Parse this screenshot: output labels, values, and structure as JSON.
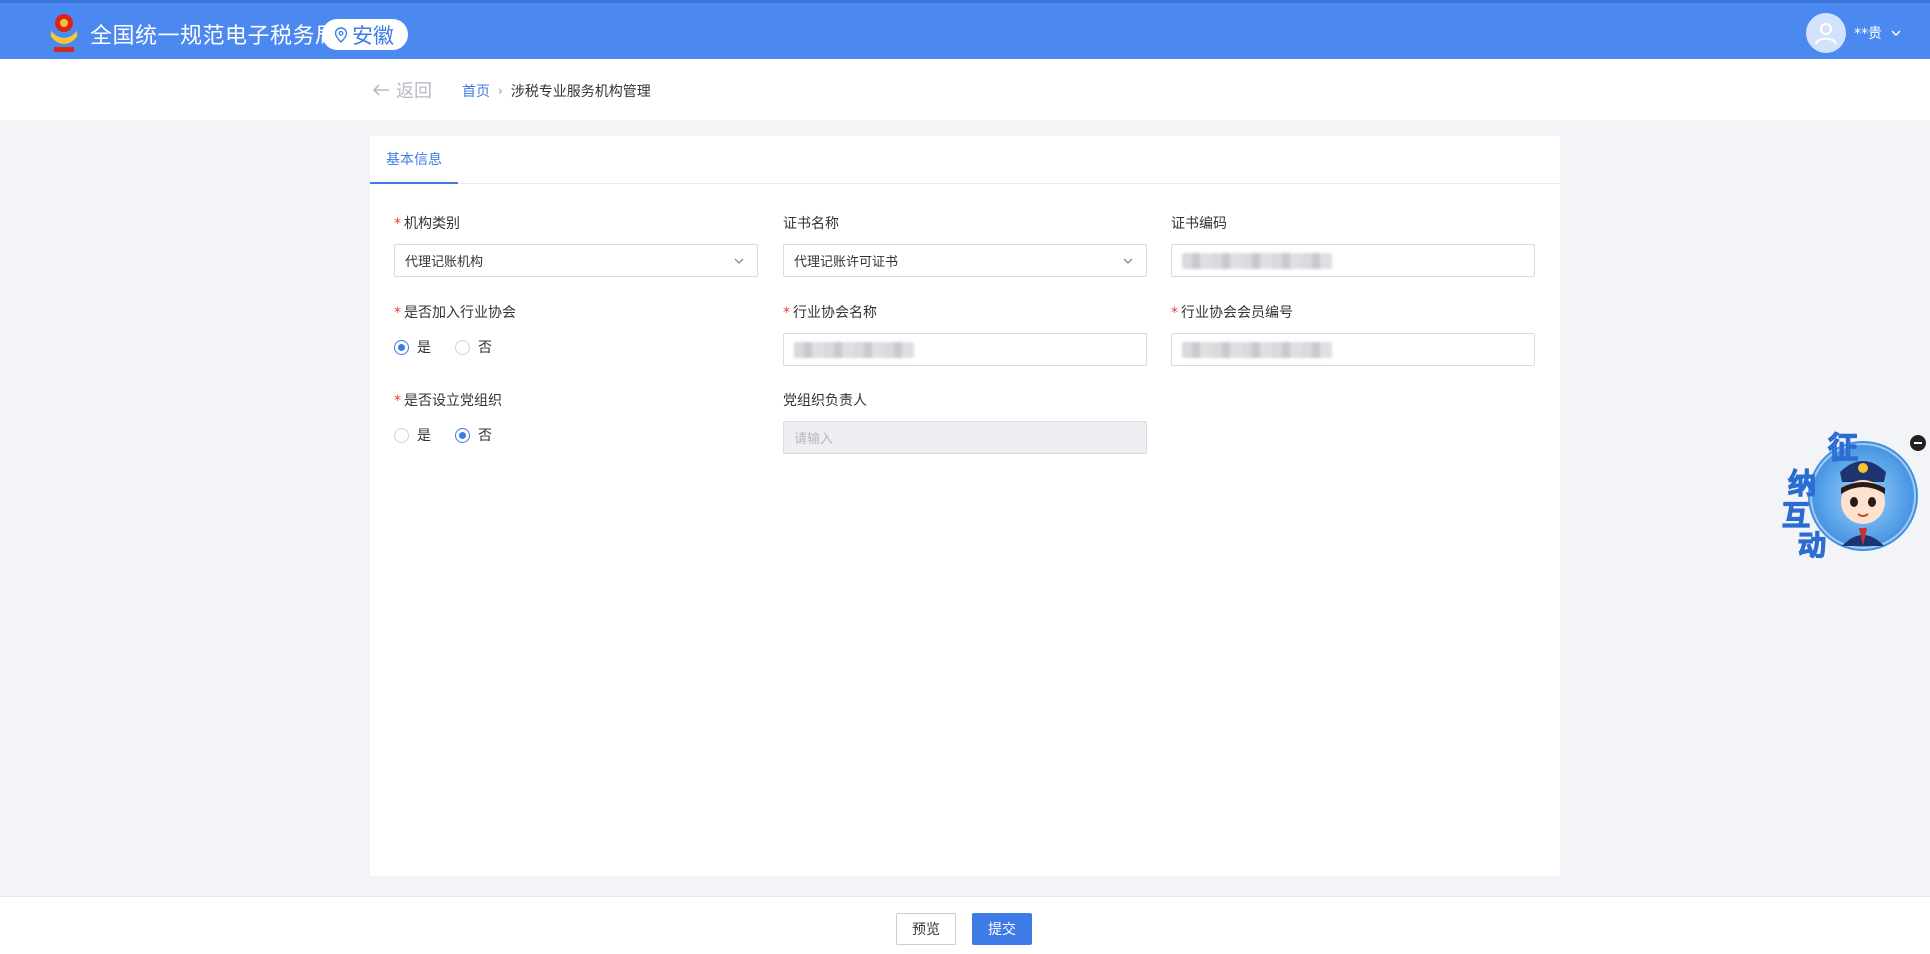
{
  "header": {
    "site_title": "全国统一规范电子税务局",
    "region": "安徽",
    "user_name": "**贵"
  },
  "breadcrumb": {
    "back_label": "返回",
    "home": "首页",
    "separator": "›",
    "current": "涉税专业服务机构管理"
  },
  "tabs": [
    {
      "label": "基本信息",
      "active": true
    }
  ],
  "form": {
    "org_type": {
      "label": "机构类别",
      "required": true,
      "value": "代理记账机构"
    },
    "cert_name": {
      "label": "证书名称",
      "required": false,
      "value": "代理记账许可证书"
    },
    "cert_code": {
      "label": "证书编码",
      "required": false,
      "value": ""
    },
    "join_assoc": {
      "label": "是否加入行业协会",
      "required": true,
      "options": [
        "是",
        "否"
      ],
      "selected": "是"
    },
    "assoc_name": {
      "label": "行业协会名称",
      "required": true,
      "value": ""
    },
    "assoc_member_no": {
      "label": "行业协会会员编号",
      "required": true,
      "value": ""
    },
    "party_org": {
      "label": "是否设立党组织",
      "required": true,
      "options": [
        "是",
        "否"
      ],
      "selected": "否"
    },
    "party_leader": {
      "label": "党组织负责人",
      "required": false,
      "placeholder": "请输入"
    }
  },
  "actions": {
    "preview_label": "预览",
    "submit_label": "提交"
  },
  "assistant": {
    "chars": [
      "征",
      "纳",
      "互",
      "动"
    ]
  },
  "colors": {
    "header_bg": "#4b88f0",
    "primary": "#3f7be6",
    "required": "#e5393b",
    "page_bg": "#f3f4f8"
  }
}
